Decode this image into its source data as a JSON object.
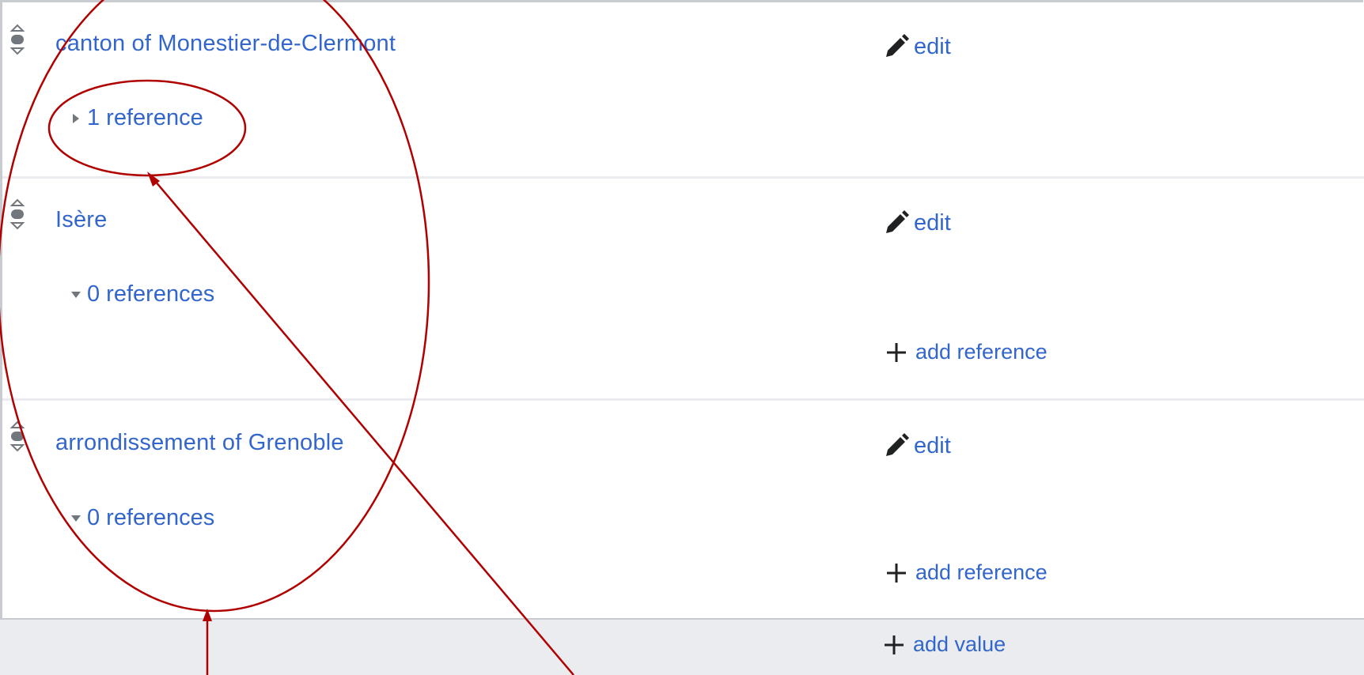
{
  "statements": [
    {
      "value": "canton of Monestier-de-Clermont",
      "edit_label": "edit",
      "references": {
        "label": "1 reference",
        "expanded": false
      },
      "add_reference_label": ""
    },
    {
      "value": "Isère",
      "edit_label": "edit",
      "references": {
        "label": "0 references",
        "expanded": true
      },
      "add_reference_label": "add reference"
    },
    {
      "value": "arrondissement of Grenoble",
      "edit_label": "edit",
      "references": {
        "label": "0 references",
        "expanded": true
      },
      "add_reference_label": "add reference"
    }
  ],
  "footer": {
    "add_value_label": "add value"
  },
  "icons": {
    "edit": "pencil-icon",
    "rank": "rank-selector-icon",
    "add": "plus-icon",
    "collapsed": "triangle-right-icon",
    "expanded": "triangle-down-icon"
  },
  "colors": {
    "link": "#3366cc",
    "annotation": "#b00000",
    "border": "#c8ccd1",
    "footer_bg": "#eaecf0"
  }
}
